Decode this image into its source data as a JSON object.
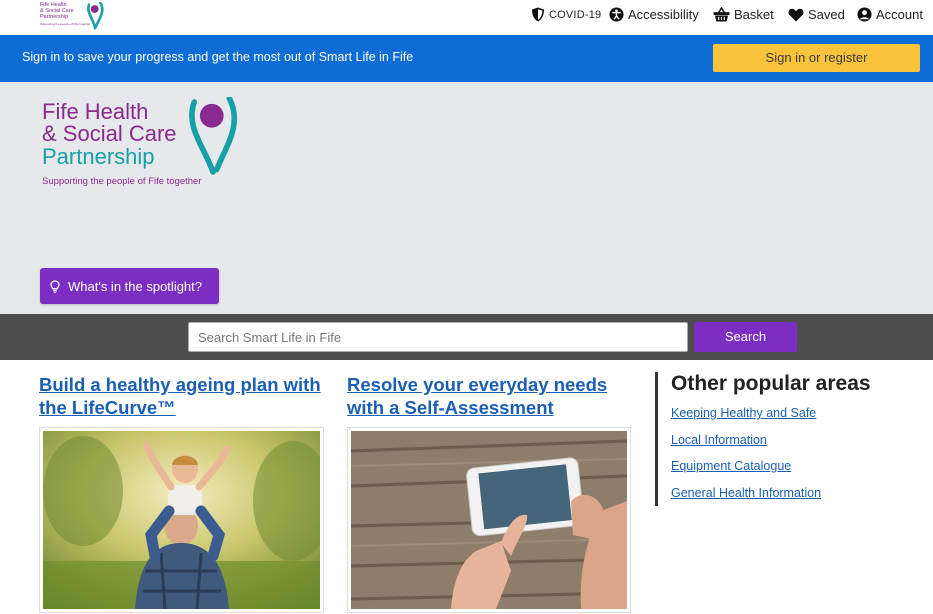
{
  "topbar": {
    "mini_logo": [
      "Fife Health",
      "& Social Care",
      "Partnership",
      "Supporting the people of Fife together"
    ],
    "links": [
      {
        "label": "COVID-19",
        "icon": "shield-icon"
      },
      {
        "label": "Accessibility",
        "icon": "accessibility-icon"
      },
      {
        "label": "Basket",
        "icon": "basket-icon"
      },
      {
        "label": "Saved",
        "icon": "heart-icon"
      },
      {
        "label": "Account",
        "icon": "user-circle-icon"
      }
    ]
  },
  "signin_bar": {
    "message": "Sign in to save your progress and get the most out of Smart Life in Fife",
    "button": "Sign in or register"
  },
  "hero": {
    "logo": {
      "line1": "Fife Health",
      "line2": "& Social Care",
      "line3": "Partnership",
      "tagline": "Supporting the people of Fife together"
    },
    "spotlight_button": "What's in the spotlight?"
  },
  "search": {
    "placeholder": "Search Smart Life in Fife",
    "value": "",
    "button": "Search"
  },
  "cards": [
    {
      "title": "Build a healthy ageing plan with the LifeCurve™",
      "image": "grandfather-with-child-on-shoulders"
    },
    {
      "title": "Resolve your everyday needs with a Self-Assessment",
      "image": "hands-holding-smartphone"
    }
  ],
  "popular": {
    "heading": "Other popular areas",
    "links": [
      "Keeping Healthy and Safe",
      "Local Information",
      "Equipment Catalogue",
      "General Health Information"
    ]
  },
  "colors": {
    "brand_purple": "#8a2a8f",
    "brand_teal": "#17a0a8",
    "signin_blue": "#0d6cd6",
    "signin_button": "#f9c33c",
    "accent_purple": "#7d2ec2",
    "search_bg": "#4d4d4d",
    "hero_bg": "#e6e8eb",
    "link_blue": "#1a5fb4"
  }
}
